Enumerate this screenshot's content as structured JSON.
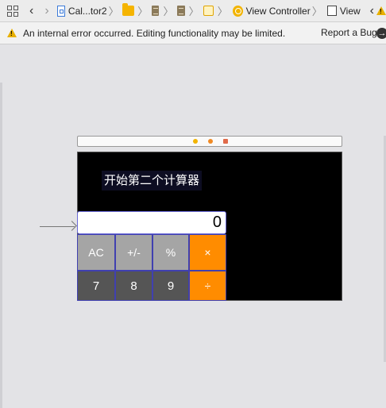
{
  "jumpbar": {
    "crumb_project": "Cal...tor2",
    "crumb_viewcontroller": "View Controller",
    "crumb_view": "View"
  },
  "warning": {
    "message": "An internal error occurred. Editing functionality may be limited.",
    "report_label": "Report a Bug"
  },
  "scene": {
    "title_label": "开始第二个计算器",
    "display_value": "0",
    "keys_row1": [
      "AC",
      "+/-",
      "%",
      "×"
    ],
    "keys_row2": [
      "7",
      "8",
      "9",
      "÷"
    ]
  },
  "colors": {
    "accent_orange": "#ff8c00",
    "key_gray": "#a5a5a5",
    "key_dark": "#555555",
    "scene_background": "#000000"
  }
}
